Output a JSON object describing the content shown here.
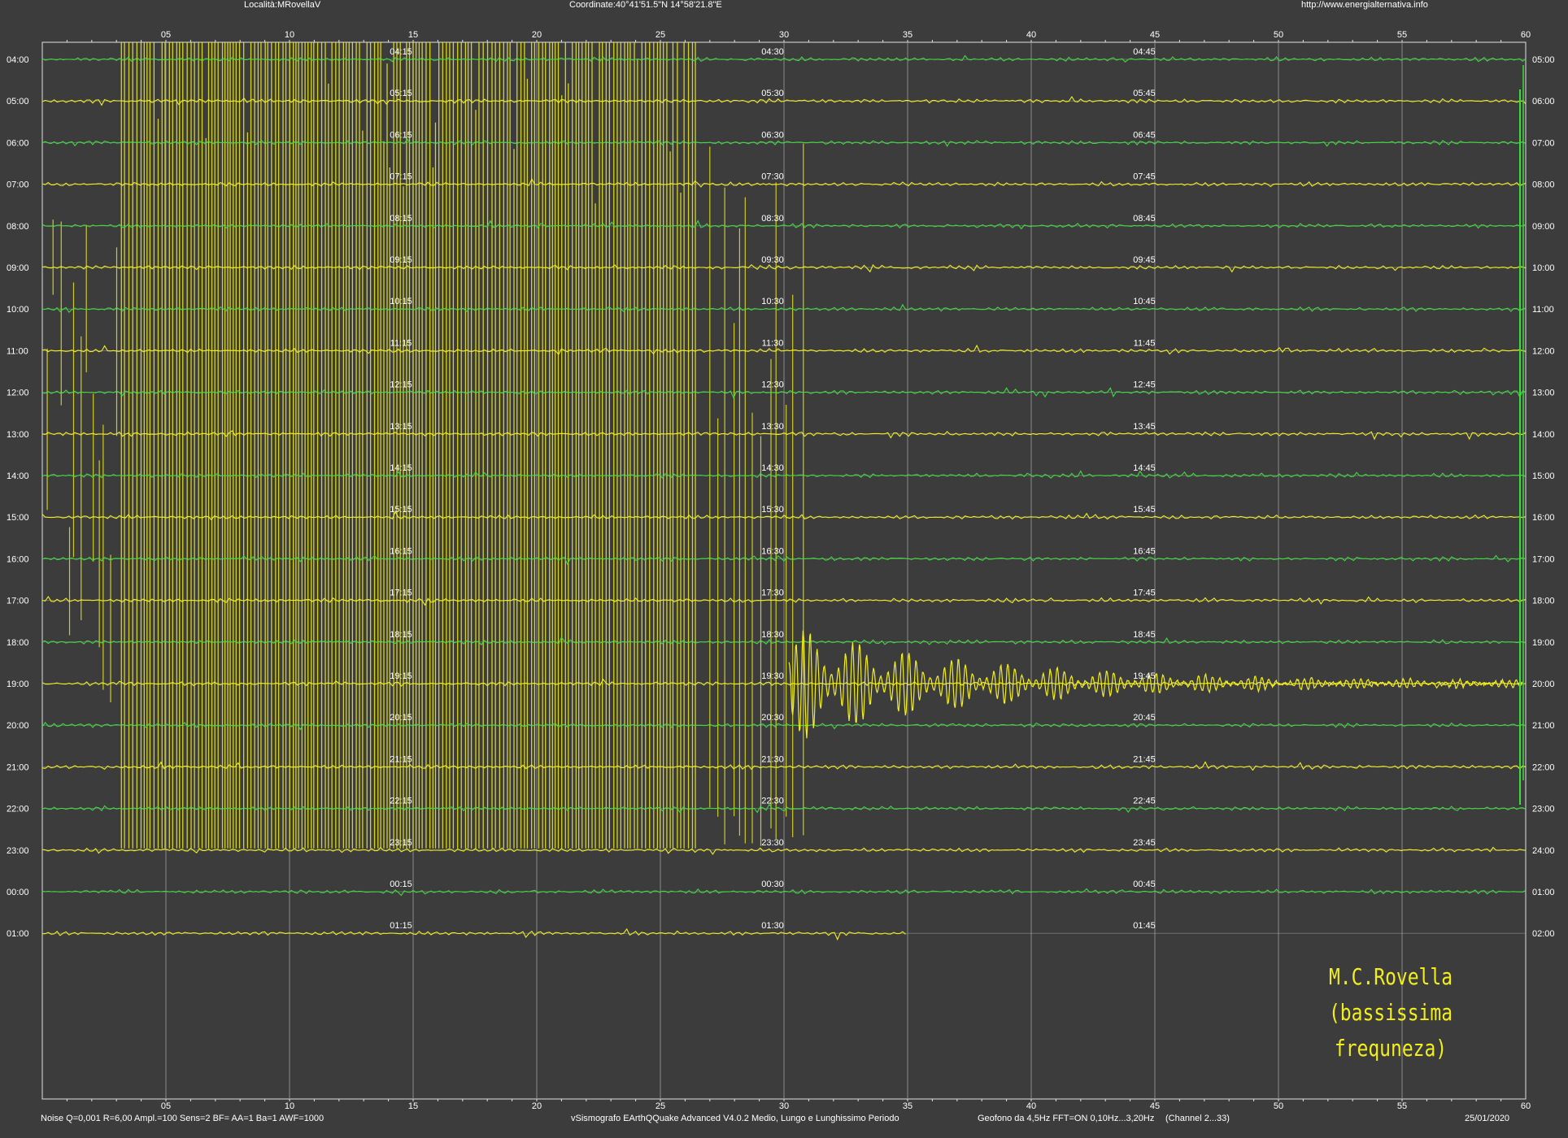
{
  "header": {
    "location": "Località:MRovellaV",
    "coordinates": "Coordinate:40°41'51.5\"N 14°58'21.8\"E",
    "url": "http://www.energialternativa.info"
  },
  "footer": {
    "params": "Noise Q=0,001 R=6,00 Ampl.=100 Sens=2 BF= AA=1 Ba=1 AWF=1000",
    "software": "vSismografo  EArthQQuake Advanced V4.0.2  Medio, Lungo e Lunghissimo Periodo",
    "geophone": "Geofono da 4,5Hz FFT=ON 0,10Hz...3,20Hz",
    "channel": "(Channel 2...33)",
    "date": "25/01/2020"
  },
  "signature": {
    "line1": "M.C.Rovella",
    "line2": "(bassissima frequneza)"
  },
  "colors": {
    "background": "#3c3c3c",
    "trace_yellow": "#f2ee1e",
    "trace_green": "#3ddc3d",
    "grid": "#8a8a8a",
    "frame": "#e0e0e0"
  },
  "chart_data": {
    "type": "line",
    "x": {
      "unit": "minutes",
      "range": [
        0,
        60
      ],
      "tick_labels": [
        "05",
        "10",
        "15",
        "20",
        "25",
        "30",
        "35",
        "40",
        "45",
        "50",
        "55",
        "60"
      ]
    },
    "rows_left_labels": [
      "04:00",
      "05:00",
      "06:00",
      "07:00",
      "08:00",
      "09:00",
      "10:00",
      "11:00",
      "12:00",
      "13:00",
      "14:00",
      "15:00",
      "16:00",
      "17:00",
      "18:00",
      "19:00",
      "20:00",
      "21:00",
      "22:00",
      "23:00",
      "00:00",
      "01:00"
    ],
    "rows_right_labels": [
      "05:00",
      "06:00",
      "07:00",
      "08:00",
      "09:00",
      "10:00",
      "11:00",
      "12:00",
      "13:00",
      "14:00",
      "15:00",
      "16:00",
      "17:00",
      "18:00",
      "19:00",
      "20:00",
      "21:00",
      "22:00",
      "23:00",
      "24:00",
      "01:00",
      "02:00"
    ],
    "inline_time_labels": [
      [
        "04:15",
        "04:30",
        "04:45"
      ],
      [
        "05:15",
        "05:30",
        "05:45"
      ],
      [
        "06:15",
        "06:30",
        "06:45"
      ],
      [
        "07:15",
        "07:30",
        "07:45"
      ],
      [
        "08:15",
        "08:30",
        "08:45"
      ],
      [
        "09:15",
        "09:30",
        "09:45"
      ],
      [
        "10:15",
        "10:30",
        "10:45"
      ],
      [
        "11:15",
        "11:30",
        "11:45"
      ],
      [
        "12:15",
        "12:30",
        "12:45"
      ],
      [
        "13:15",
        "13:30",
        "13:45"
      ],
      [
        "14:15",
        "14:30",
        "14:45"
      ],
      [
        "15:15",
        "15:30",
        "15:45"
      ],
      [
        "16:15",
        "16:30",
        "16:45"
      ],
      [
        "17:15",
        "17:30",
        "17:45"
      ],
      [
        "18:15",
        "18:30",
        "18:45"
      ],
      [
        "19:15",
        "19:30",
        "19:45"
      ],
      [
        "20:15",
        "20:30",
        "20:45"
      ],
      [
        "21:15",
        "21:30",
        "21:45"
      ],
      [
        "22:15",
        "22:30",
        "22:45"
      ],
      [
        "23:15",
        "23:30",
        "23:45"
      ],
      [
        "00:15",
        "00:30",
        "00:45"
      ],
      [
        "01:15",
        "01:30",
        "01:45"
      ]
    ],
    "row_colors": [
      "green",
      "yellow",
      "green",
      "yellow",
      "green",
      "yellow",
      "green",
      "yellow",
      "green",
      "yellow",
      "green",
      "yellow",
      "green",
      "yellow",
      "green",
      "yellow",
      "green",
      "yellow",
      "green",
      "yellow",
      "green",
      "yellow"
    ],
    "saturated_band": {
      "rows": [
        0,
        19
      ],
      "minute_range": [
        3.2,
        26.5
      ]
    },
    "decay_tail_row": 15,
    "recording_end_minute": 35
  }
}
